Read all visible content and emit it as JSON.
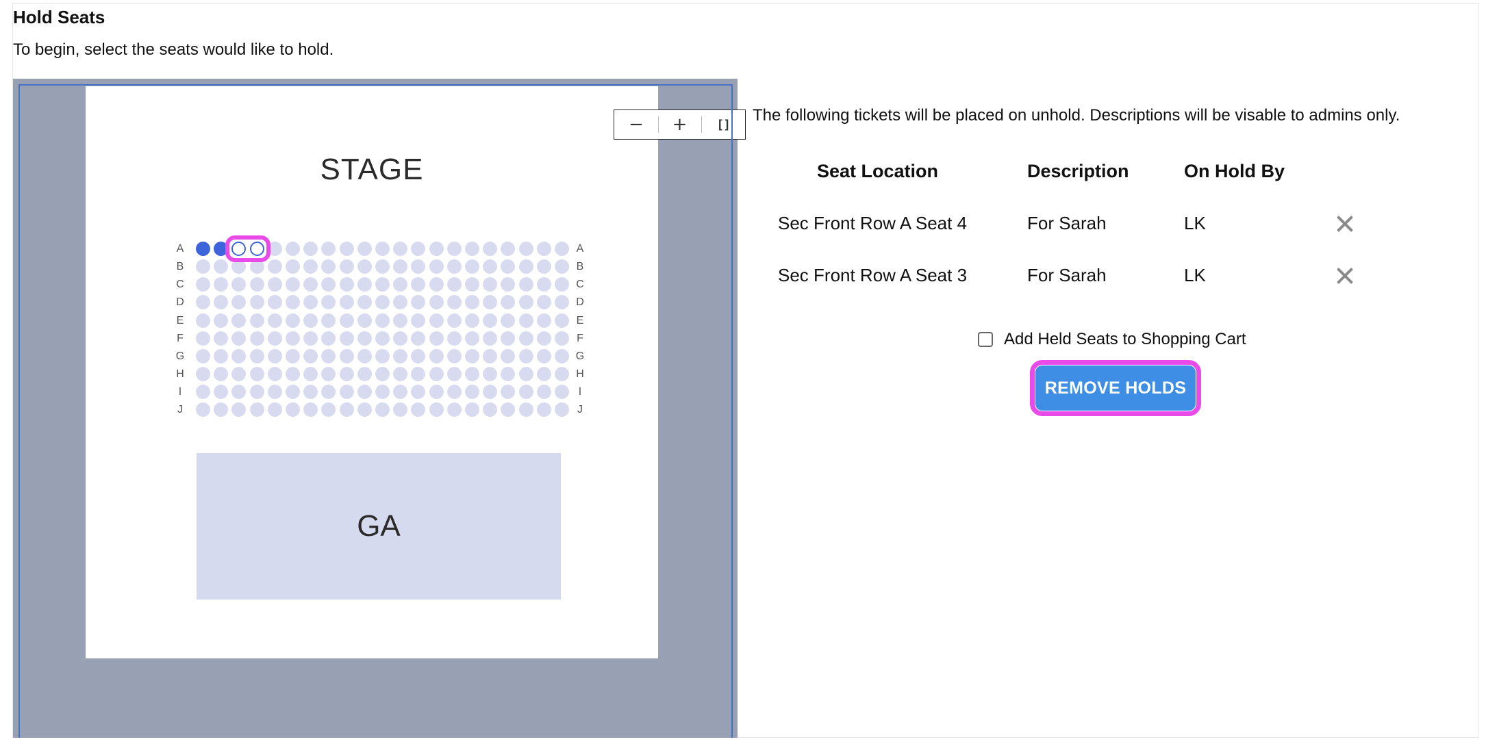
{
  "page": {
    "title": "Hold Seats",
    "subtitle": "To begin, select the seats would like to hold."
  },
  "seat_map": {
    "stage_label": "STAGE",
    "ga_label": "GA",
    "zoom_controls": {
      "zoom_out_icon": "minus-icon",
      "zoom_in_icon": "plus-icon",
      "fit_icon": "fit-to-screen-icon"
    },
    "rows": [
      "A",
      "B",
      "C",
      "D",
      "E",
      "F",
      "G",
      "H",
      "I",
      "J"
    ],
    "seats_per_row": 21,
    "held_seats": [
      "A1",
      "A2"
    ],
    "selected_seats": [
      "A3",
      "A4"
    ],
    "colors": {
      "available": "#d8dbef",
      "held": "#3d64db",
      "highlight": "#e94be8",
      "map_background": "#98a1b3"
    }
  },
  "hold_panel": {
    "intro": "The following tickets will be placed on unhold. Descriptions will be visable to admins only.",
    "columns": {
      "seat_location": "Seat Location",
      "description": "Description",
      "on_hold_by": "On Hold By"
    },
    "rows": [
      {
        "seat_location": "Sec Front Row A Seat 4",
        "description": "For Sarah",
        "on_hold_by": "LK"
      },
      {
        "seat_location": "Sec Front Row A Seat 3",
        "description": "For Sarah",
        "on_hold_by": "LK"
      }
    ],
    "cart_checkbox_label": "Add Held Seats to Shopping Cart",
    "cart_checkbox_checked": false,
    "remove_button_label": "REMOVE HOLDS",
    "colors": {
      "button": "#3f8ee6",
      "highlight": "#e94be8"
    }
  }
}
